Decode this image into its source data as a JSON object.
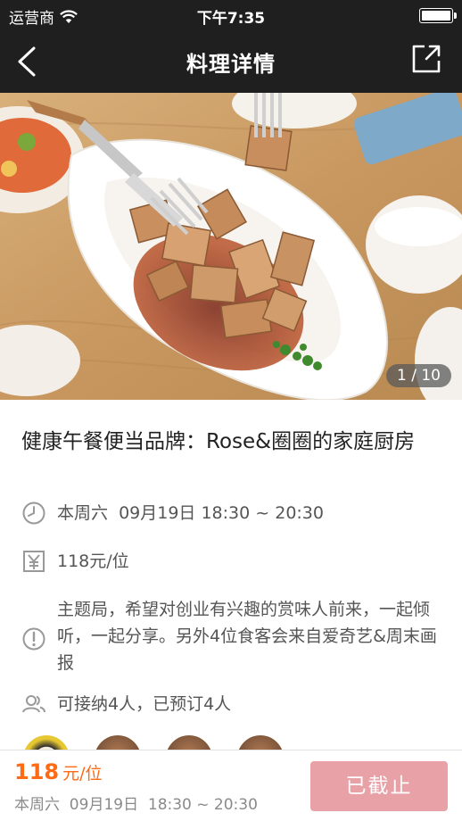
{
  "status_bar": {
    "carrier": "运营商",
    "time": "下午7:35"
  },
  "nav": {
    "title": "料理详情",
    "back_icon": "chevron-left-icon",
    "share_icon": "share-external-icon"
  },
  "hero": {
    "pager": "1 / 10",
    "current_index": 1,
    "total": 10
  },
  "event": {
    "title": "健康午餐便当品牌：Rose&圈圈的家庭厨房",
    "time_text": "本周六  09月19日 18:30 ~ 20:30",
    "price_text": "118元/位",
    "description": "主题局，希望对创业有兴趣的赏味人前来，一起倾听，一起分享。另外4位食客会来自爱奇艺&周末画报",
    "capacity_text": "可接纳4人，已预订4人",
    "capacity": 4,
    "booked": 4,
    "icons": {
      "time": "clock-icon",
      "price": "yen-icon",
      "description": "info-icon",
      "capacity": "people-icon"
    }
  },
  "bottom_bar": {
    "price_value": "118",
    "price_unit": "元/位",
    "time_text": "本周六  09月19日  18:30 ~ 20:30",
    "cta_label": "已截止"
  },
  "colors": {
    "accent": "#ff6a14",
    "cta_disabled": "#e8a2a7",
    "bar_background": "#1f1f1f"
  }
}
